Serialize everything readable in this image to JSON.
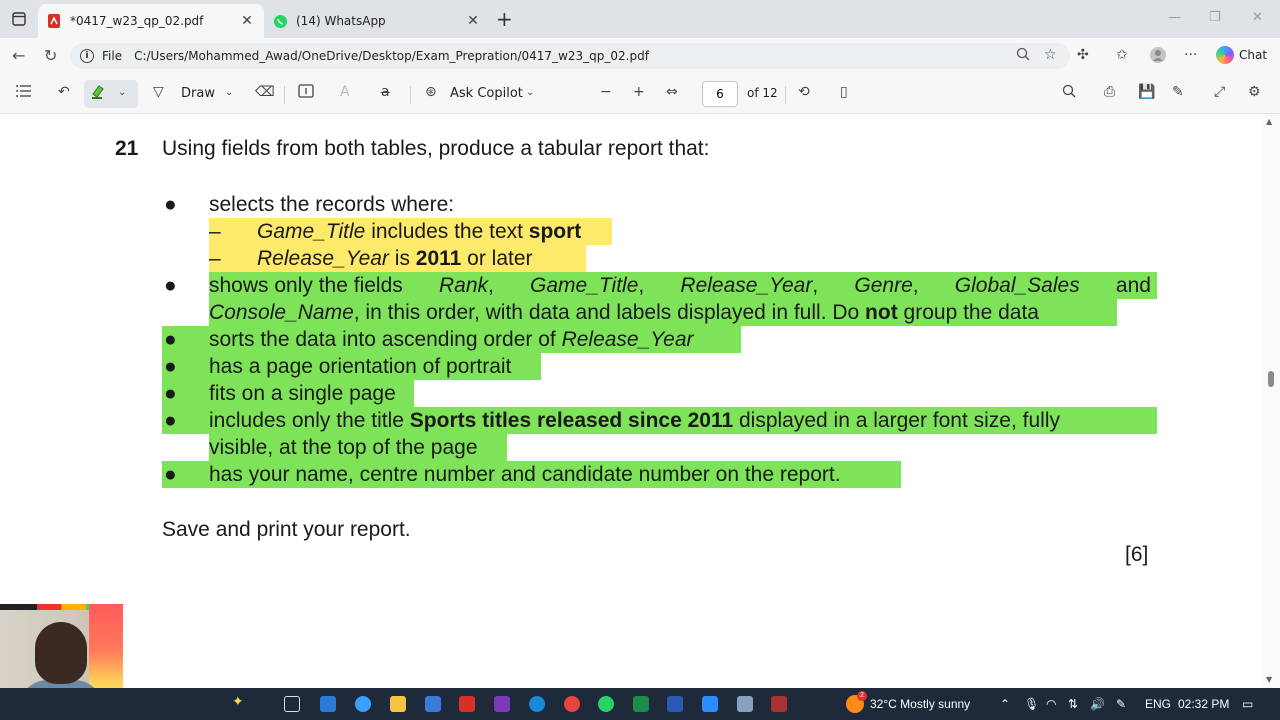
{
  "tabs": [
    {
      "title": "*0417_w23_qp_02.pdf",
      "icon": "pdf-icon"
    },
    {
      "title": "(14) WhatsApp",
      "icon": "whatsapp-icon"
    }
  ],
  "address": {
    "scheme_label": "File",
    "url": "C:/Users/Mohammed_Awad/OneDrive/Desktop/Exam_Prepration/0417_w23_qp_02.pdf"
  },
  "browser": {
    "chat_label": "Chat"
  },
  "pdf_toolbar": {
    "draw_label": "Draw",
    "copilot_label": "Ask Copilot",
    "page_value": "6",
    "page_total": "of 12"
  },
  "question": {
    "number": "21",
    "intro": "Using fields from both tables, produce a tabular report that:",
    "b1": "selects the records where:",
    "d1_field": "Game_Title",
    "d1_mid": " includes the text ",
    "d1_value": "sport",
    "d2_field": "Release_Year",
    "d2_mid": " is ",
    "d2_value": "2011",
    "d2_end": " or later",
    "b2_l1_a": "shows only the fields",
    "b2_l1_rank": "Rank",
    "b2_l1_gt": "Game_Title",
    "b2_l1_ry": "Release_Year",
    "b2_l1_genre": "Genre",
    "b2_l1_gs": "Global_Sales",
    "b2_l1_and": "and",
    "b2_l2_cn": "Console_Name",
    "b2_l2_mid": ", in this order, with data and labels displayed in full. Do ",
    "b2_l2_not": "not",
    "b2_l2_end": " group the data",
    "b3_a": "sorts the data into ascending order of ",
    "b3_field": "Release_Year",
    "b4": "has a page orientation of portrait",
    "b5": "fits on a single page",
    "b6_a": "includes only the title ",
    "b6_title": "Sports titles released since 2011",
    "b6_b": " displayed in a larger font size, fully",
    "b6_l2": "visible, at the top of the page",
    "b7": "has your name, centre number and candidate number on the report.",
    "save": "Save and print your report.",
    "marks": "[6]"
  },
  "taskbar": {
    "weather": "32°C  Mostly sunny",
    "weather_badge": "2",
    "lang": "ENG",
    "time": "02:32 PM"
  },
  "colors": {
    "highlight_yellow": "#fde96a",
    "highlight_green": "#7fe35a",
    "taskbar": "#1e2a3a"
  }
}
